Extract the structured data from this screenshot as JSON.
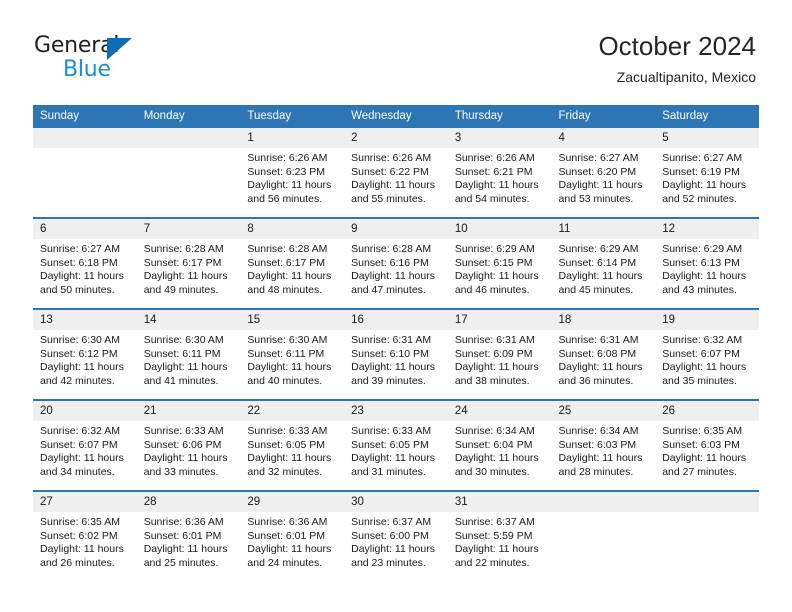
{
  "brand": {
    "name_top": "General",
    "name_bottom": "Blue",
    "accent_blue": "#1b8ce3",
    "triangle_blue": "#0c6cb5"
  },
  "header": {
    "title": "October 2024",
    "location": "Zacualtipanito, Mexico",
    "header_bg": "#2e75b6",
    "daynum_bg": "#efefef"
  },
  "weekday_headers": [
    "Sunday",
    "Monday",
    "Tuesday",
    "Wednesday",
    "Thursday",
    "Friday",
    "Saturday"
  ],
  "labels": {
    "sunrise_prefix": "Sunrise: ",
    "sunset_prefix": "Sunset: ",
    "daylight_prefix": "Daylight: "
  },
  "weeks": [
    [
      {
        "day": "",
        "lines": []
      },
      {
        "day": "",
        "lines": []
      },
      {
        "day": "1",
        "lines": [
          "Sunrise: 6:26 AM",
          "Sunset: 6:23 PM",
          "Daylight: 11 hours and 56 minutes."
        ]
      },
      {
        "day": "2",
        "lines": [
          "Sunrise: 6:26 AM",
          "Sunset: 6:22 PM",
          "Daylight: 11 hours and 55 minutes."
        ]
      },
      {
        "day": "3",
        "lines": [
          "Sunrise: 6:26 AM",
          "Sunset: 6:21 PM",
          "Daylight: 11 hours and 54 minutes."
        ]
      },
      {
        "day": "4",
        "lines": [
          "Sunrise: 6:27 AM",
          "Sunset: 6:20 PM",
          "Daylight: 11 hours and 53 minutes."
        ]
      },
      {
        "day": "5",
        "lines": [
          "Sunrise: 6:27 AM",
          "Sunset: 6:19 PM",
          "Daylight: 11 hours and 52 minutes."
        ]
      }
    ],
    [
      {
        "day": "6",
        "lines": [
          "Sunrise: 6:27 AM",
          "Sunset: 6:18 PM",
          "Daylight: 11 hours and 50 minutes."
        ]
      },
      {
        "day": "7",
        "lines": [
          "Sunrise: 6:28 AM",
          "Sunset: 6:17 PM",
          "Daylight: 11 hours and 49 minutes."
        ]
      },
      {
        "day": "8",
        "lines": [
          "Sunrise: 6:28 AM",
          "Sunset: 6:17 PM",
          "Daylight: 11 hours and 48 minutes."
        ]
      },
      {
        "day": "9",
        "lines": [
          "Sunrise: 6:28 AM",
          "Sunset: 6:16 PM",
          "Daylight: 11 hours and 47 minutes."
        ]
      },
      {
        "day": "10",
        "lines": [
          "Sunrise: 6:29 AM",
          "Sunset: 6:15 PM",
          "Daylight: 11 hours and 46 minutes."
        ]
      },
      {
        "day": "11",
        "lines": [
          "Sunrise: 6:29 AM",
          "Sunset: 6:14 PM",
          "Daylight: 11 hours and 45 minutes."
        ]
      },
      {
        "day": "12",
        "lines": [
          "Sunrise: 6:29 AM",
          "Sunset: 6:13 PM",
          "Daylight: 11 hours and 43 minutes."
        ]
      }
    ],
    [
      {
        "day": "13",
        "lines": [
          "Sunrise: 6:30 AM",
          "Sunset: 6:12 PM",
          "Daylight: 11 hours and 42 minutes."
        ]
      },
      {
        "day": "14",
        "lines": [
          "Sunrise: 6:30 AM",
          "Sunset: 6:11 PM",
          "Daylight: 11 hours and 41 minutes."
        ]
      },
      {
        "day": "15",
        "lines": [
          "Sunrise: 6:30 AM",
          "Sunset: 6:11 PM",
          "Daylight: 11 hours and 40 minutes."
        ]
      },
      {
        "day": "16",
        "lines": [
          "Sunrise: 6:31 AM",
          "Sunset: 6:10 PM",
          "Daylight: 11 hours and 39 minutes."
        ]
      },
      {
        "day": "17",
        "lines": [
          "Sunrise: 6:31 AM",
          "Sunset: 6:09 PM",
          "Daylight: 11 hours and 38 minutes."
        ]
      },
      {
        "day": "18",
        "lines": [
          "Sunrise: 6:31 AM",
          "Sunset: 6:08 PM",
          "Daylight: 11 hours and 36 minutes."
        ]
      },
      {
        "day": "19",
        "lines": [
          "Sunrise: 6:32 AM",
          "Sunset: 6:07 PM",
          "Daylight: 11 hours and 35 minutes."
        ]
      }
    ],
    [
      {
        "day": "20",
        "lines": [
          "Sunrise: 6:32 AM",
          "Sunset: 6:07 PM",
          "Daylight: 11 hours and 34 minutes."
        ]
      },
      {
        "day": "21",
        "lines": [
          "Sunrise: 6:33 AM",
          "Sunset: 6:06 PM",
          "Daylight: 11 hours and 33 minutes."
        ]
      },
      {
        "day": "22",
        "lines": [
          "Sunrise: 6:33 AM",
          "Sunset: 6:05 PM",
          "Daylight: 11 hours and 32 minutes."
        ]
      },
      {
        "day": "23",
        "lines": [
          "Sunrise: 6:33 AM",
          "Sunset: 6:05 PM",
          "Daylight: 11 hours and 31 minutes."
        ]
      },
      {
        "day": "24",
        "lines": [
          "Sunrise: 6:34 AM",
          "Sunset: 6:04 PM",
          "Daylight: 11 hours and 30 minutes."
        ]
      },
      {
        "day": "25",
        "lines": [
          "Sunrise: 6:34 AM",
          "Sunset: 6:03 PM",
          "Daylight: 11 hours and 28 minutes."
        ]
      },
      {
        "day": "26",
        "lines": [
          "Sunrise: 6:35 AM",
          "Sunset: 6:03 PM",
          "Daylight: 11 hours and 27 minutes."
        ]
      }
    ],
    [
      {
        "day": "27",
        "lines": [
          "Sunrise: 6:35 AM",
          "Sunset: 6:02 PM",
          "Daylight: 11 hours and 26 minutes."
        ]
      },
      {
        "day": "28",
        "lines": [
          "Sunrise: 6:36 AM",
          "Sunset: 6:01 PM",
          "Daylight: 11 hours and 25 minutes."
        ]
      },
      {
        "day": "29",
        "lines": [
          "Sunrise: 6:36 AM",
          "Sunset: 6:01 PM",
          "Daylight: 11 hours and 24 minutes."
        ]
      },
      {
        "day": "30",
        "lines": [
          "Sunrise: 6:37 AM",
          "Sunset: 6:00 PM",
          "Daylight: 11 hours and 23 minutes."
        ]
      },
      {
        "day": "31",
        "lines": [
          "Sunrise: 6:37 AM",
          "Sunset: 5:59 PM",
          "Daylight: 11 hours and 22 minutes."
        ]
      },
      {
        "day": "",
        "lines": []
      },
      {
        "day": "",
        "lines": []
      }
    ]
  ]
}
